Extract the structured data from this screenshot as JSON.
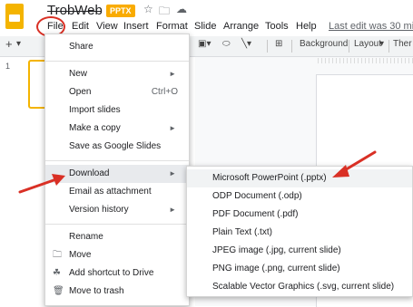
{
  "app": {
    "title": "TrobWeb",
    "badge": "PPTX",
    "menubar": [
      "File",
      "Edit",
      "View",
      "Insert",
      "Format",
      "Slide",
      "Arrange",
      "Tools",
      "Help"
    ],
    "last_edit": "Last edit was 30 minu"
  },
  "toolbar": {
    "add": "+",
    "background": "Background",
    "layout": "Layout",
    "theme": "Ther"
  },
  "filmstrip": {
    "slide_number": "1"
  },
  "file_menu": [
    {
      "label": "Share"
    },
    {
      "label": "New",
      "arrow": "►"
    },
    {
      "label": "Open",
      "shortcut": "Ctrl+O"
    },
    {
      "label": "Import slides"
    },
    {
      "label": "Make a copy",
      "arrow": "►"
    },
    {
      "label": "Save as Google Slides"
    },
    {
      "label": "Download",
      "arrow": "►"
    },
    {
      "label": "Email as attachment"
    },
    {
      "label": "Version history",
      "arrow": "►"
    },
    {
      "label": "Rename"
    },
    {
      "label": "Move",
      "icon": "folder-icon"
    },
    {
      "label": "Add shortcut to Drive",
      "icon": "drive-shortcut-icon"
    },
    {
      "label": "Move to trash",
      "icon": "trash-icon"
    }
  ],
  "download_submenu": [
    {
      "label": "Microsoft PowerPoint (.pptx)"
    },
    {
      "label": "ODP Document (.odp)"
    },
    {
      "label": "PDF Document (.pdf)"
    },
    {
      "label": "Plain Text (.txt)"
    },
    {
      "label": "JPEG image (.jpg, current slide)"
    },
    {
      "label": "PNG image (.png, current slide)"
    },
    {
      "label": "Scalable Vector Graphics (.svg, current slide)"
    }
  ],
  "colors": {
    "accent": "#f4b400",
    "badge": "#f9ab00",
    "annotation_red": "#d93025",
    "menu_highlight": "#e8eaed"
  }
}
